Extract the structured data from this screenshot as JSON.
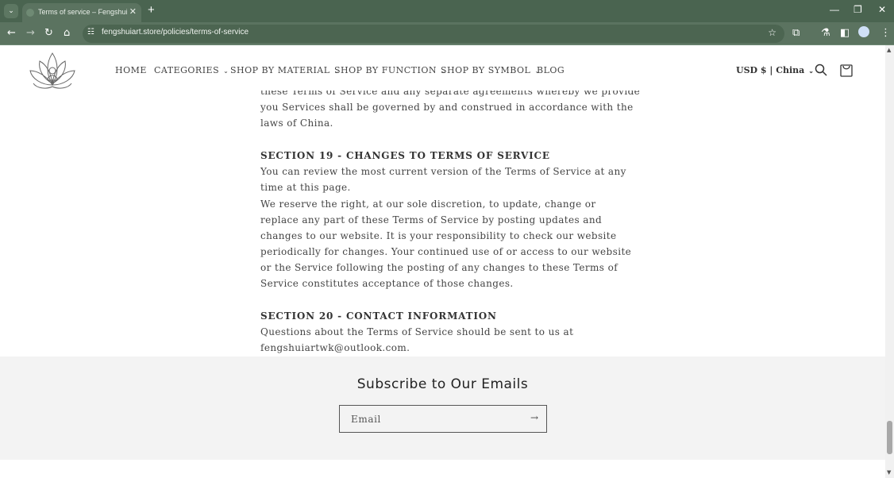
{
  "browser": {
    "tab_title": "Terms of service – Fengshui",
    "url": "fengshuiart.store/policies/terms-of-service"
  },
  "nav": {
    "items": [
      {
        "label": "HOME",
        "dropdown": false
      },
      {
        "label": "CATEGORIES",
        "dropdown": true
      },
      {
        "label": "SHOP BY MATERIAL",
        "dropdown": true
      },
      {
        "label": "SHOP BY FUNCTION",
        "dropdown": true
      },
      {
        "label": "SHOP BY SYMBOL",
        "dropdown": true
      },
      {
        "label": "BLOG",
        "dropdown": false
      }
    ],
    "currency": "USD $ | China"
  },
  "content": {
    "partial_line": "these Terms of Service and any separate agreements whereby we provide",
    "intro": "you Services shall be governed by and construed in accordance with the laws of China.",
    "s19_title": "SECTION 19 - CHANGES TO TERMS OF SERVICE",
    "s19_p1": "You can review the most current version of the Terms of Service at any time at this page.",
    "s19_p2": "We reserve the right, at our sole discretion, to update, change or replace any part of these Terms of Service by posting updates and changes to our website. It is your responsibility to check our website periodically for changes. Your continued use of or access to our website or the Service following the posting of any changes to these Terms of Service constitutes acceptance of those changes.",
    "s20_title": "SECTION 20 - CONTACT INFORMATION",
    "s20_p1": "Questions about the Terms of Service should be sent to us at fengshuiartwk@outlook.com."
  },
  "footer": {
    "title": "Subscribe to Our Emails",
    "email_placeholder": "Email"
  },
  "colors": {
    "chrome": "#4a6450",
    "footer_bg": "#f3f3f3"
  }
}
